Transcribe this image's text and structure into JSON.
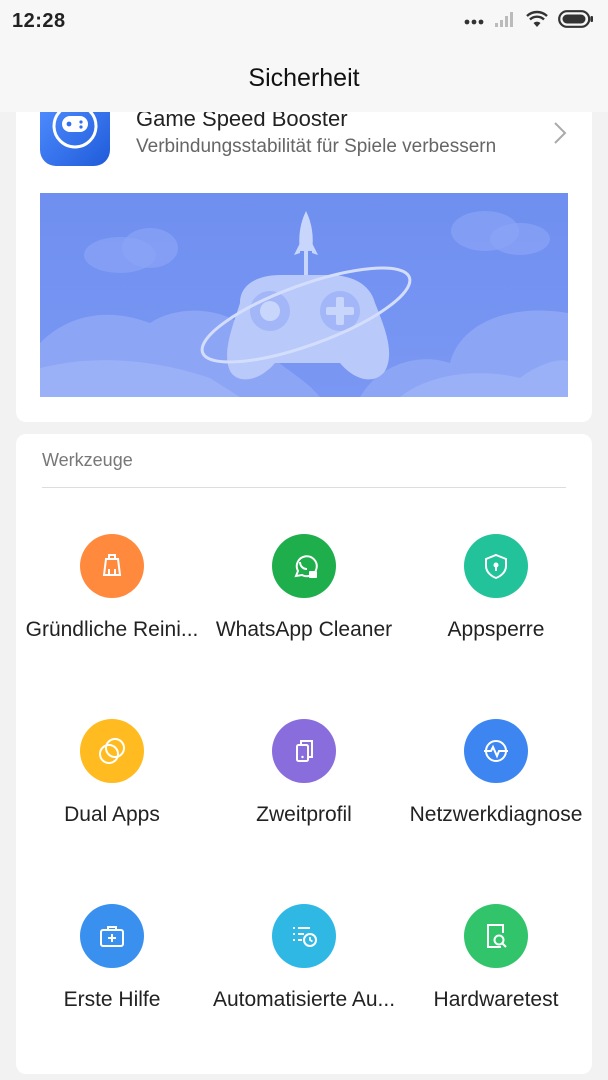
{
  "status_bar": {
    "time": "12:28"
  },
  "header": {
    "title": "Sicherheit"
  },
  "promo": {
    "title": "Game Speed Booster",
    "subtitle": "Verbindungsstabilität für Spiele verbessern"
  },
  "tools_section": {
    "title": "Werkzeuge",
    "items": [
      {
        "label": "Gründliche Reini...",
        "icon": "broom-icon",
        "color": "#ff8a3d"
      },
      {
        "label": "WhatsApp Cleaner",
        "icon": "whatsapp-icon",
        "color": "#1fae4c"
      },
      {
        "label": "Appsperre",
        "icon": "shield-lock-icon",
        "color": "#22c39a"
      },
      {
        "label": "Dual Apps",
        "icon": "dual-circles-icon",
        "color": "#ffbb1f"
      },
      {
        "label": "Zweitprofil",
        "icon": "profiles-icon",
        "color": "#8a6ddc"
      },
      {
        "label": "Netzwerkdiagnose",
        "icon": "network-pulse-icon",
        "color": "#3d86f2"
      },
      {
        "label": "Erste Hilfe",
        "icon": "first-aid-kit-icon",
        "color": "#3a90ee"
      },
      {
        "label": "Automatisierte Au...",
        "icon": "schedule-list-icon",
        "color": "#30b8e4"
      },
      {
        "label": "Hardwaretest",
        "icon": "device-search-icon",
        "color": "#31c46a"
      }
    ]
  },
  "colors": {
    "background": "#f2f2f2",
    "banner": "#7592f2",
    "promo_icon": "#2f6ff0"
  }
}
